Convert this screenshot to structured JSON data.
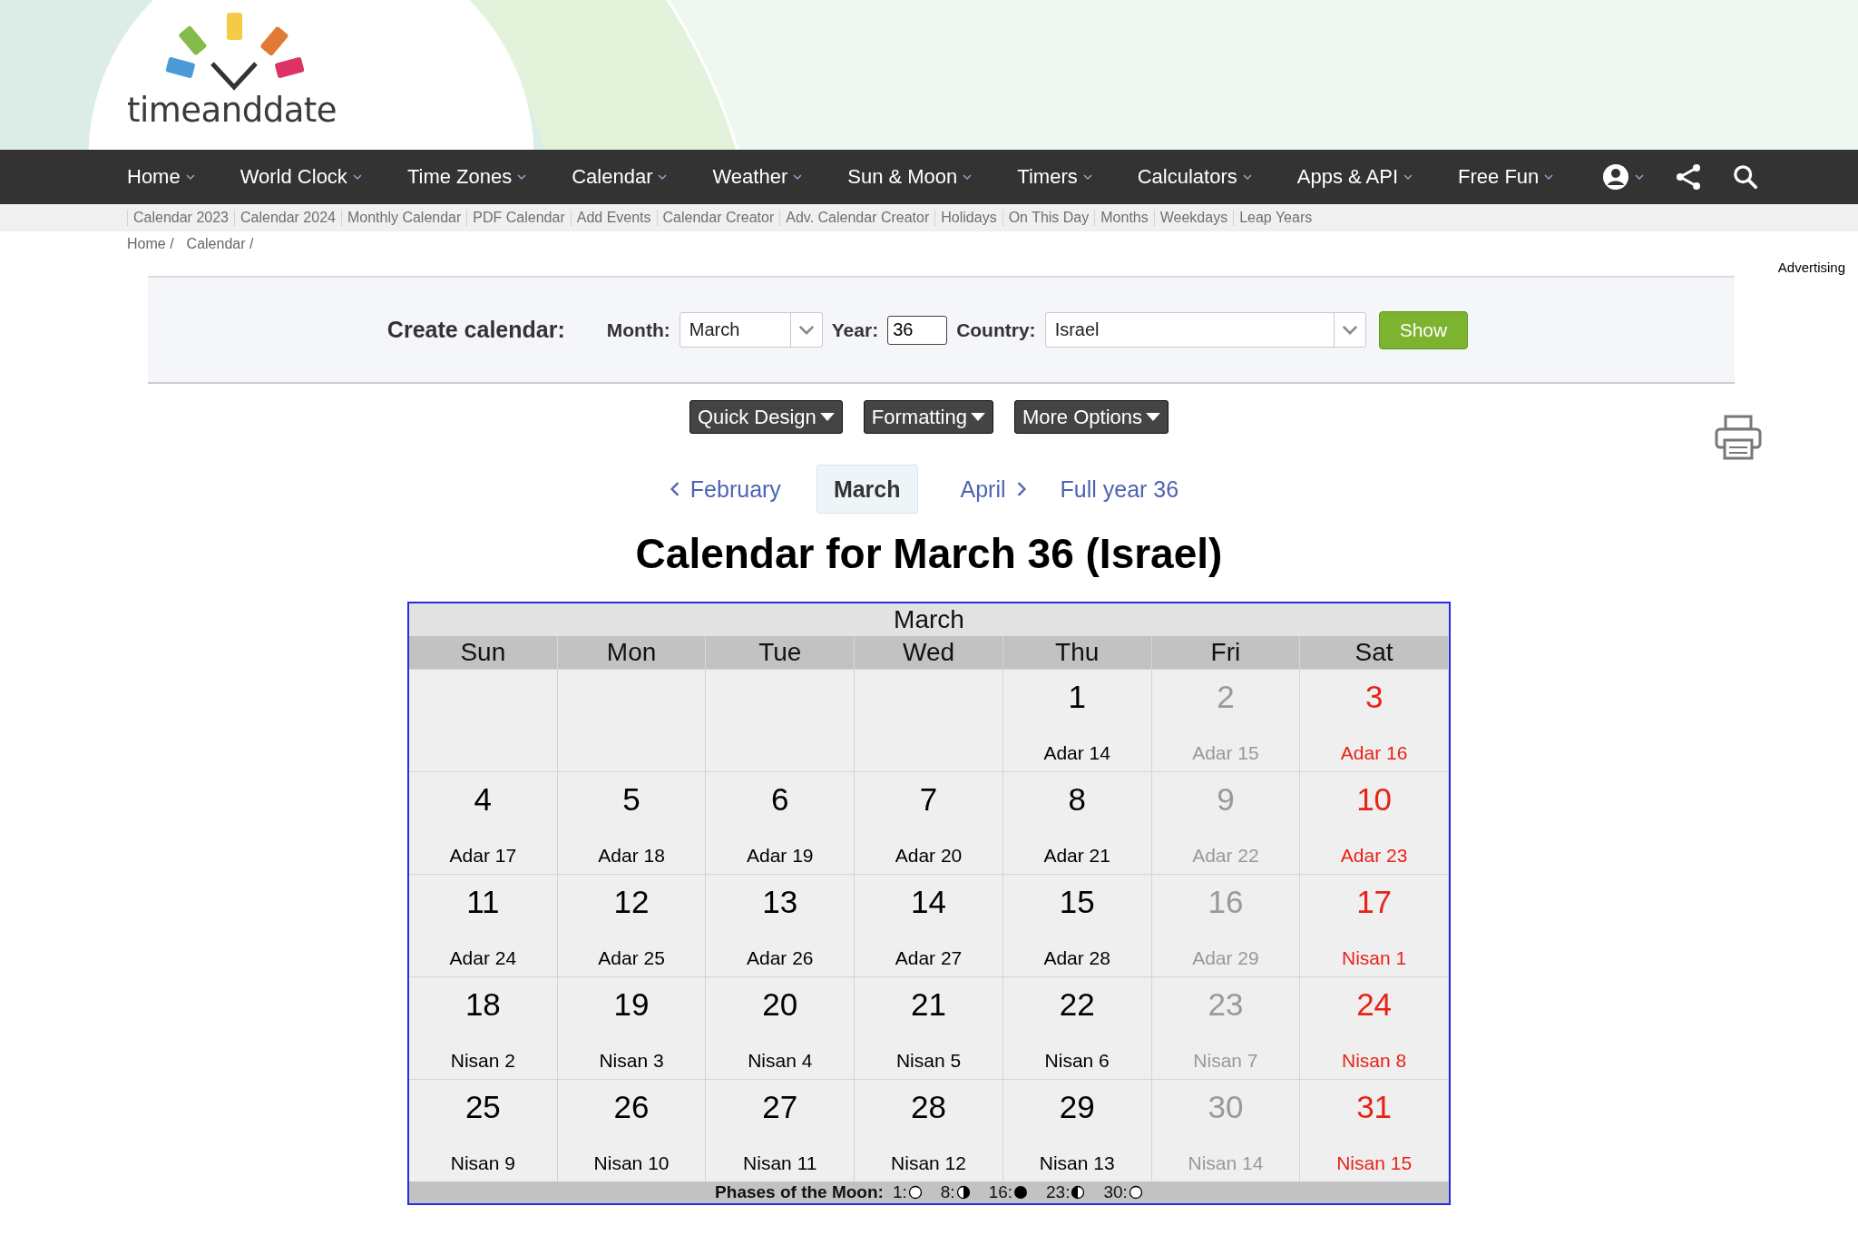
{
  "logo": {
    "text": "timeanddate"
  },
  "nav": [
    {
      "label": "Home"
    },
    {
      "label": "World Clock"
    },
    {
      "label": "Time Zones"
    },
    {
      "label": "Calendar"
    },
    {
      "label": "Weather"
    },
    {
      "label": "Sun & Moon"
    },
    {
      "label": "Timers"
    },
    {
      "label": "Calculators"
    },
    {
      "label": "Apps & API"
    },
    {
      "label": "Free Fun"
    }
  ],
  "subnav": [
    "Calendar 2023",
    "Calendar 2024",
    "Monthly Calendar",
    "PDF Calendar",
    "Add Events",
    "Calendar Creator",
    "Adv. Calendar Creator",
    "Holidays",
    "On This Day",
    "Months",
    "Weekdays",
    "Leap Years"
  ],
  "breadcrumb": [
    "Home /",
    "Calendar /"
  ],
  "advertising": "Advertising",
  "form": {
    "title": "Create calendar:",
    "month_label": "Month:",
    "month_value": "March",
    "year_label": "Year:",
    "year_value": "36",
    "country_label": "Country:",
    "country_value": "Israel",
    "submit": "Show"
  },
  "option_buttons": [
    "Quick Design",
    "Formatting",
    "More Options"
  ],
  "month_nav": [
    {
      "label": "February",
      "kind": "prev",
      "selected": false
    },
    {
      "label": "March",
      "kind": "current",
      "selected": true
    },
    {
      "label": "April",
      "kind": "next",
      "selected": false
    },
    {
      "label": "Full year 36",
      "kind": "year",
      "selected": false
    }
  ],
  "title": "Calendar for March 36 (Israel)",
  "calendar": {
    "month": "March",
    "weekdays": [
      "Sun",
      "Mon",
      "Tue",
      "Wed",
      "Thu",
      "Fri",
      "Sat"
    ],
    "weeks": [
      [
        {
          "kind": "blank"
        },
        {
          "kind": "blank"
        },
        {
          "kind": "blank"
        },
        {
          "kind": "blank"
        },
        {
          "kind": "normal",
          "day": "1",
          "hebrew": "Adar 14"
        },
        {
          "kind": "friday",
          "day": "2",
          "hebrew": "Adar 15"
        },
        {
          "kind": "saturday",
          "day": "3",
          "hebrew": "Adar 16"
        }
      ],
      [
        {
          "kind": "normal",
          "day": "4",
          "hebrew": "Adar 17"
        },
        {
          "kind": "normal",
          "day": "5",
          "hebrew": "Adar 18"
        },
        {
          "kind": "normal",
          "day": "6",
          "hebrew": "Adar 19"
        },
        {
          "kind": "normal",
          "day": "7",
          "hebrew": "Adar 20"
        },
        {
          "kind": "normal",
          "day": "8",
          "hebrew": "Adar 21"
        },
        {
          "kind": "friday",
          "day": "9",
          "hebrew": "Adar 22"
        },
        {
          "kind": "saturday",
          "day": "10",
          "hebrew": "Adar 23"
        }
      ],
      [
        {
          "kind": "normal",
          "day": "11",
          "hebrew": "Adar 24"
        },
        {
          "kind": "normal",
          "day": "12",
          "hebrew": "Adar 25"
        },
        {
          "kind": "normal",
          "day": "13",
          "hebrew": "Adar 26"
        },
        {
          "kind": "normal",
          "day": "14",
          "hebrew": "Adar 27"
        },
        {
          "kind": "normal",
          "day": "15",
          "hebrew": "Adar 28"
        },
        {
          "kind": "friday",
          "day": "16",
          "hebrew": "Adar 29"
        },
        {
          "kind": "saturday",
          "day": "17",
          "hebrew": "Nisan 1"
        }
      ],
      [
        {
          "kind": "normal",
          "day": "18",
          "hebrew": "Nisan 2"
        },
        {
          "kind": "normal",
          "day": "19",
          "hebrew": "Nisan 3"
        },
        {
          "kind": "normal",
          "day": "20",
          "hebrew": "Nisan 4"
        },
        {
          "kind": "normal",
          "day": "21",
          "hebrew": "Nisan 5"
        },
        {
          "kind": "normal",
          "day": "22",
          "hebrew": "Nisan 6"
        },
        {
          "kind": "friday",
          "day": "23",
          "hebrew": "Nisan 7"
        },
        {
          "kind": "saturday",
          "day": "24",
          "hebrew": "Nisan 8"
        }
      ],
      [
        {
          "kind": "normal",
          "day": "25",
          "hebrew": "Nisan 9"
        },
        {
          "kind": "normal",
          "day": "26",
          "hebrew": "Nisan 10"
        },
        {
          "kind": "normal",
          "day": "27",
          "hebrew": "Nisan 11"
        },
        {
          "kind": "normal",
          "day": "28",
          "hebrew": "Nisan 12"
        },
        {
          "kind": "normal",
          "day": "29",
          "hebrew": "Nisan 13"
        },
        {
          "kind": "friday",
          "day": "30",
          "hebrew": "Nisan 14"
        },
        {
          "kind": "saturday",
          "day": "31",
          "hebrew": "Nisan 15"
        }
      ]
    ]
  },
  "moon_phases": {
    "label": "Phases of the Moon:",
    "items": [
      {
        "date": "1:",
        "kind": "full"
      },
      {
        "date": "8:",
        "kind": "last-quarter"
      },
      {
        "date": "16:",
        "kind": "new"
      },
      {
        "date": "23:",
        "kind": "first-quarter"
      },
      {
        "date": "30:",
        "kind": "full"
      }
    ]
  }
}
